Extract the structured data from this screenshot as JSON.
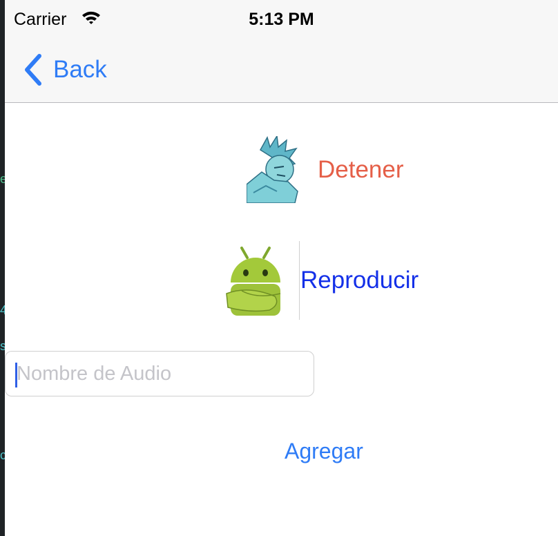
{
  "statusbar": {
    "carrier": "Carrier",
    "time": "5:13 PM",
    "wifi_icon": "wifi-icon"
  },
  "navbar": {
    "back_label": "Back",
    "back_icon": "chevron-left-icon"
  },
  "stop": {
    "label": "Detener",
    "image": "ice-character-image"
  },
  "play": {
    "label": "Reproducir",
    "image": "android-robot-image"
  },
  "audio_field": {
    "placeholder": "Nombre de Audio",
    "value": ""
  },
  "add_button": {
    "label": "Agregar"
  },
  "colors": {
    "accent": "#2f7cf6",
    "stop": "#e55f48",
    "play": "#1430e8"
  }
}
